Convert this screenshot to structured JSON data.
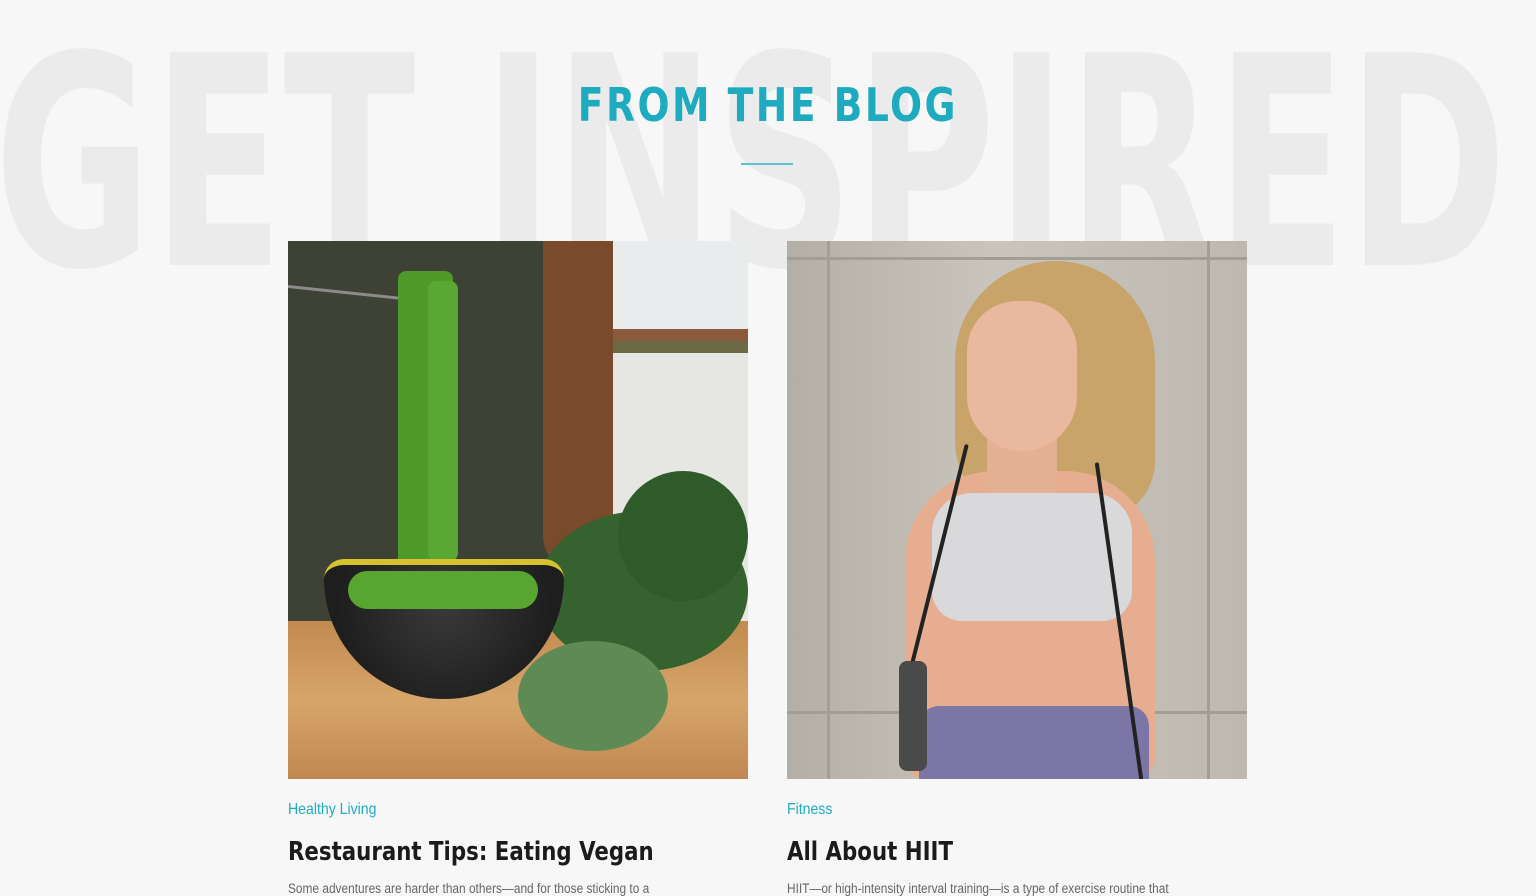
{
  "background_word": "GET INSPIRED",
  "section": {
    "title": "FROM THE BLOG",
    "accent_color": "#1eabc0"
  },
  "posts": [
    {
      "category": "Healthy Living",
      "title": "Restaurant Tips: Eating Vegan",
      "excerpt": "Some adventures are harder than others—and for those sticking to a",
      "image_alt": "Green noodles lifted from a patterned bowl beside kale"
    },
    {
      "category": "Fitness",
      "title": "All About HIIT",
      "excerpt": "HIIT—or high-intensity interval training—is a type of exercise routine that",
      "image_alt": "Woman in sports bra holding a jump rope"
    }
  ]
}
